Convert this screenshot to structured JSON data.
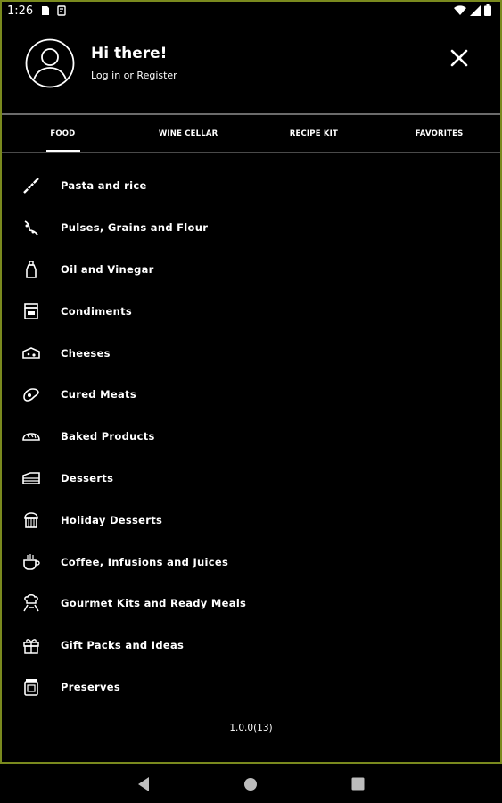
{
  "status_bar": {
    "time": "1:26"
  },
  "header": {
    "greeting": "Hi there!",
    "login": "Log in or Register"
  },
  "tabs": [
    {
      "label": "FOOD",
      "active": true
    },
    {
      "label": "WINE CELLAR",
      "active": false
    },
    {
      "label": "RECIPE KIT",
      "active": false
    },
    {
      "label": "FAVORITES",
      "active": false
    }
  ],
  "menu": [
    {
      "label": "Pasta and rice",
      "icon": "pasta-icon"
    },
    {
      "label": "Pulses, Grains and Flour",
      "icon": "grains-icon"
    },
    {
      "label": "Oil and Vinegar",
      "icon": "oil-bottle-icon"
    },
    {
      "label": "Condiments",
      "icon": "jar-icon"
    },
    {
      "label": "Cheeses",
      "icon": "cheese-icon"
    },
    {
      "label": "Cured Meats",
      "icon": "ham-icon"
    },
    {
      "label": "Baked Products",
      "icon": "bread-icon"
    },
    {
      "label": "Desserts",
      "icon": "cake-icon"
    },
    {
      "label": "Holiday Desserts",
      "icon": "panettone-icon"
    },
    {
      "label": "Coffee, Infusions and Juices",
      "icon": "coffee-cup-icon"
    },
    {
      "label": "Gourmet Kits and Ready Meals",
      "icon": "chef-icon"
    },
    {
      "label": "Gift Packs and Ideas",
      "icon": "gift-icon"
    },
    {
      "label": "Preserves",
      "icon": "preserve-jar-icon"
    }
  ],
  "version": "1.0.0(13)",
  "colors": {
    "accent_border": "#7a8a1e",
    "background": "#000000",
    "text": "#ffffff"
  }
}
